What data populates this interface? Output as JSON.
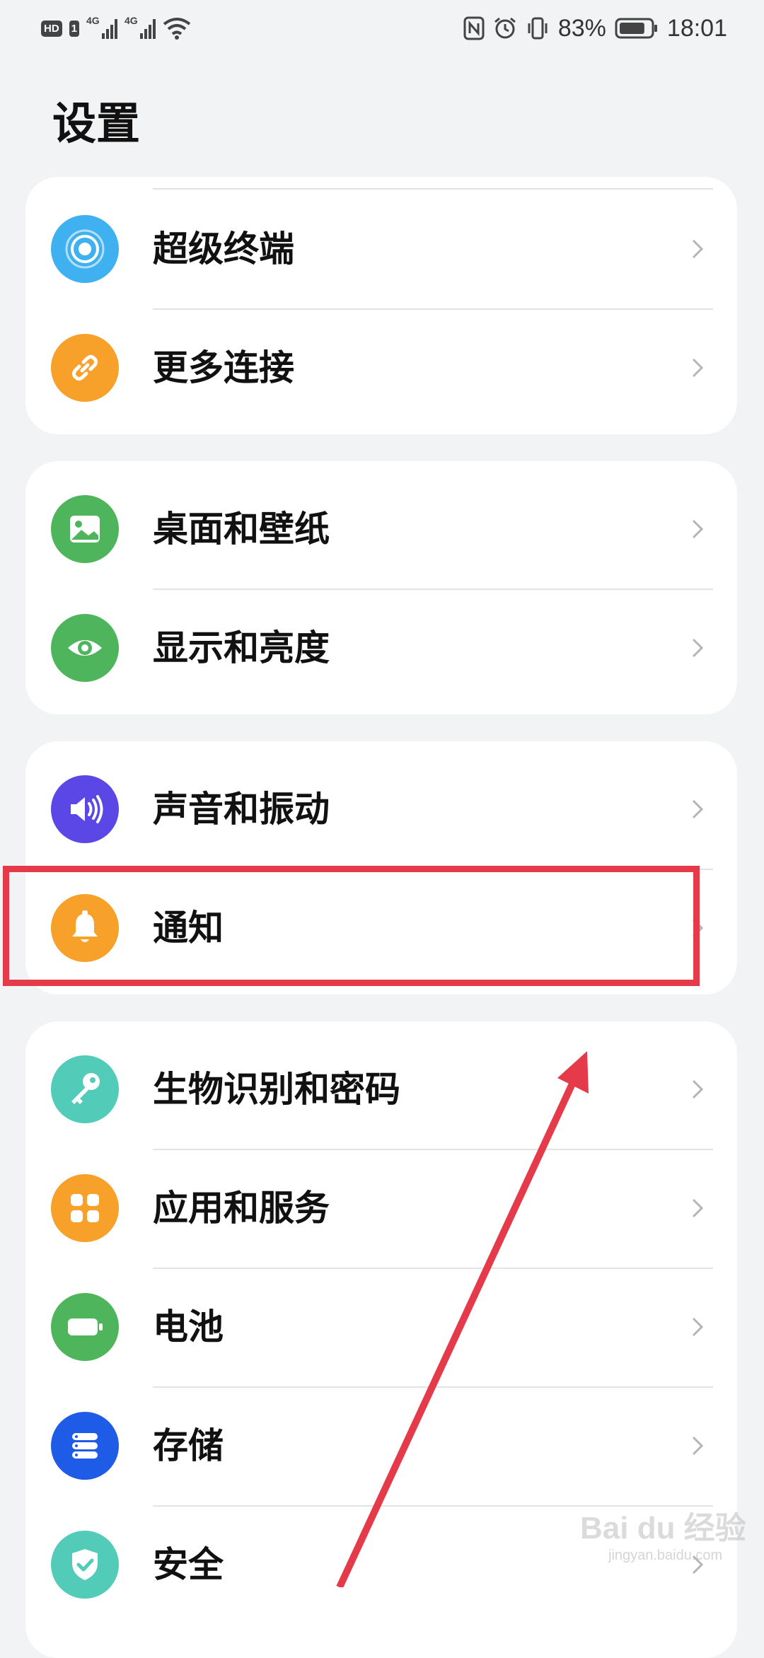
{
  "status_bar": {
    "hd": "HD",
    "sim": "1",
    "net1": "4G",
    "net2": "4G",
    "battery_percent": "83%",
    "time": "18:01",
    "battery_level": 0.83
  },
  "page_title": "设置",
  "groups": [
    {
      "items": [
        {
          "label": "超级终端",
          "icon": "super-device-icon",
          "color": "#3fb1f0"
        },
        {
          "label": "更多连接",
          "icon": "link-icon",
          "color": "#f7a02a"
        }
      ]
    },
    {
      "items": [
        {
          "label": "桌面和壁纸",
          "icon": "wallpaper-icon",
          "color": "#4fb55c"
        },
        {
          "label": "显示和亮度",
          "icon": "eye-icon",
          "color": "#4fb55c"
        }
      ]
    },
    {
      "items": [
        {
          "label": "声音和振动",
          "icon": "sound-icon",
          "color": "#5a47e6"
        },
        {
          "label": "通知",
          "icon": "bell-icon",
          "color": "#f7a02a"
        }
      ]
    },
    {
      "items": [
        {
          "label": "生物识别和密码",
          "icon": "key-icon",
          "color": "#52cbb8"
        },
        {
          "label": "应用和服务",
          "icon": "apps-icon",
          "color": "#f7a02a"
        },
        {
          "label": "电池",
          "icon": "battery-icon",
          "color": "#4fb55c"
        },
        {
          "label": "存储",
          "icon": "storage-icon",
          "color": "#1e5ce8"
        },
        {
          "label": "安全",
          "icon": "shield-icon",
          "color": "#52cbb8"
        }
      ]
    }
  ],
  "annotation_color": "#e43a4a",
  "watermark": {
    "brand": "Bai du 经验",
    "url": "jingyan.baidu.com"
  }
}
